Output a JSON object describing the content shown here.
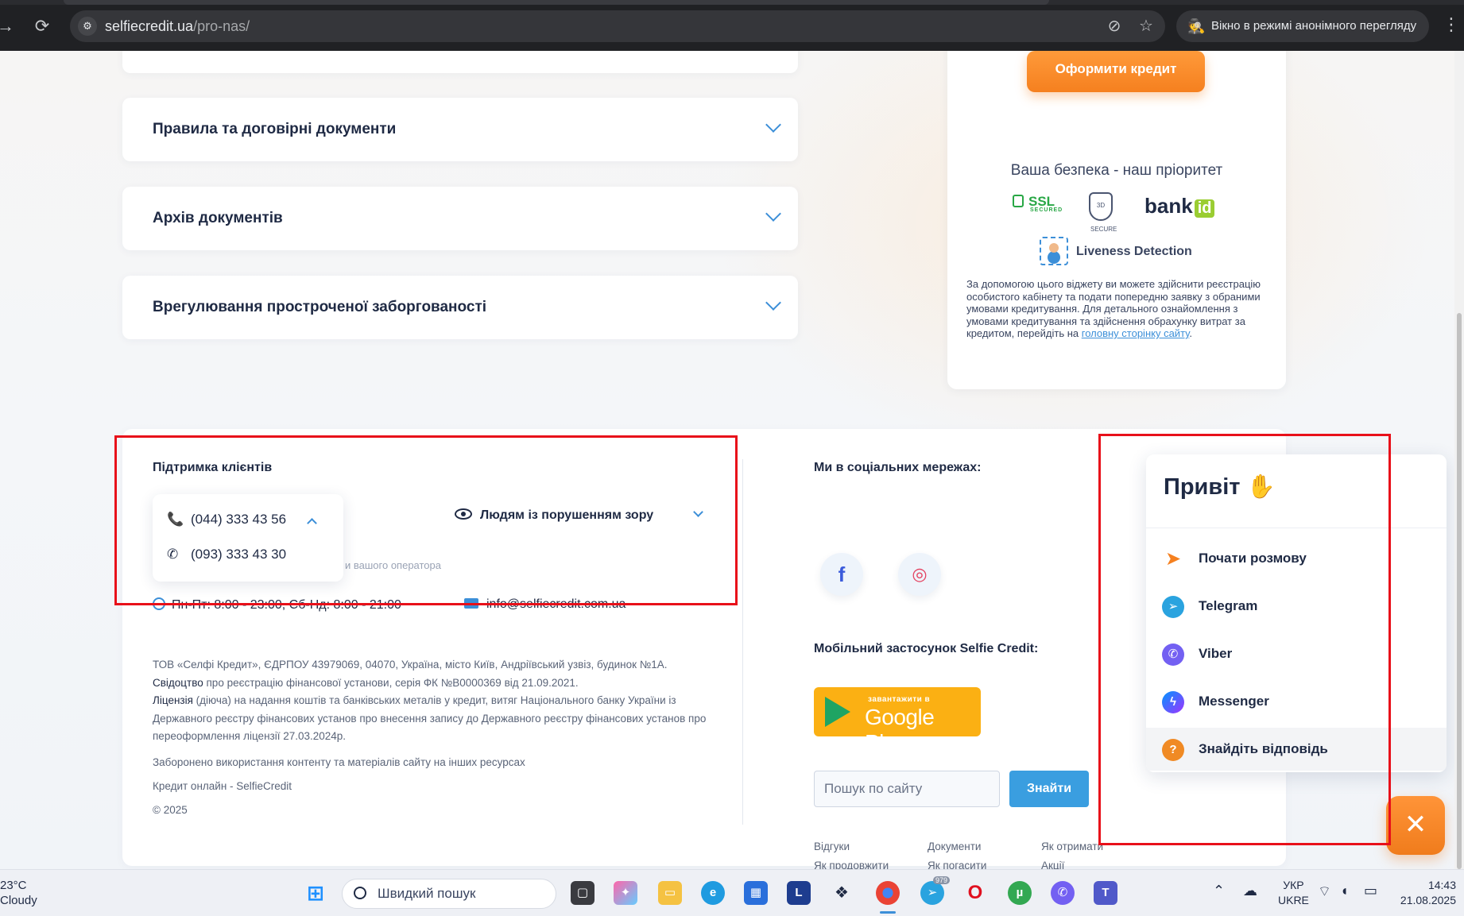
{
  "browser": {
    "url_host": "selfiecredit.ua",
    "url_path": "/pro-nas/",
    "incognito_label": "Вікно в режимі анонімного перегляду"
  },
  "accordion": [
    {
      "label": "Правила та договірні документи"
    },
    {
      "label": "Архів документів"
    },
    {
      "label": "Врегулювання простроченої заборгованості"
    }
  ],
  "side_card": {
    "cta_label": "Оформити кредит",
    "security_title": "Ваша безпека - наш пріоритет",
    "ssl_label": "SSL",
    "ssl_sub": "SECURED",
    "secure3d_label": "3D SECURE",
    "bankid_text": "bank",
    "bankid_badge": "id",
    "liveness_label": "Liveness Detection",
    "disclaimer_text": "За допомогою цього віджету ви можете здійснити реєстрацію особистого кабінету та подати попередню заявку з обраними умовами кредитування. Для детального ознайомлення з умовами кредитування та здійснення обрахунку витрат за кредитом, перейдіть на ",
    "disclaimer_link": "головну сторінку сайту",
    "disclaimer_end": "."
  },
  "footer": {
    "support_title": "Підтримка клієнтів",
    "phones": [
      "(044) 333 43 56",
      "(093) 333 43 30"
    ],
    "operator_hint": "и вашого оператора",
    "vision_label": "Людям із порушенням зору",
    "hours": "Пн-Пт: 8:00 - 23:00, Сб-Нд: 8:00 - 21:00",
    "email": "info@selfiecredit.com.ua",
    "legal_company": "ТОВ «Селфі Кредит», ЄДРПОУ 43979069, 04070, Україна, місто Київ, Андріївський узвіз, будинок №1А.",
    "legal_cert_bold": "Свідоцтво",
    "legal_cert": " про реєстрацію фінансової установи, серія ФК №B0000369 від 21.09.2021.",
    "legal_license_bold": "Ліцензія",
    "legal_license": " (діюча) на надання коштів та банківських металів у кредит, витяг Національного банку України із Державного реєстру фінансових установ про внесення запису до Державного реєстру фінансових установ про переоформлення ліцензії 27.03.2024р.",
    "forbidden": "Заборонено використання контенту та матеріалів сайту на інших ресурсах",
    "brand_line": "Кредит онлайн - SelfieCredit",
    "copyright": "© 2025",
    "social_title": "Ми в соціальних мережах:",
    "app_title": "Мобільний застосунок Selfie Credit:",
    "gplay_small": "завантажити в",
    "gplay_big": "Google Play",
    "search_placeholder": "Пошук по сайту",
    "search_button": "Знайти",
    "links": [
      "Відгуки",
      "Документи",
      "Як отримати",
      "Як продовжити",
      "Як погасити",
      "Акції"
    ]
  },
  "chat": {
    "greeting": "Привіт",
    "greeting_emoji": "✋",
    "items": [
      {
        "label": "Почати розмову"
      },
      {
        "label": "Telegram"
      },
      {
        "label": "Viber"
      },
      {
        "label": "Messenger"
      },
      {
        "label": "Знайдіть відповідь"
      }
    ]
  },
  "taskbar": {
    "temp": "23°C",
    "weather": "Cloudy",
    "search_placeholder": "Швидкий пошук",
    "telegram_badge": "979",
    "lang_top": "УКР",
    "lang_bottom": "UKRE",
    "time": "14:43",
    "date": "21.08.2025"
  },
  "colors": {
    "accent_orange": "#f5801f",
    "accent_blue": "#3c8fd8",
    "annotation_red": "#e8101a"
  }
}
